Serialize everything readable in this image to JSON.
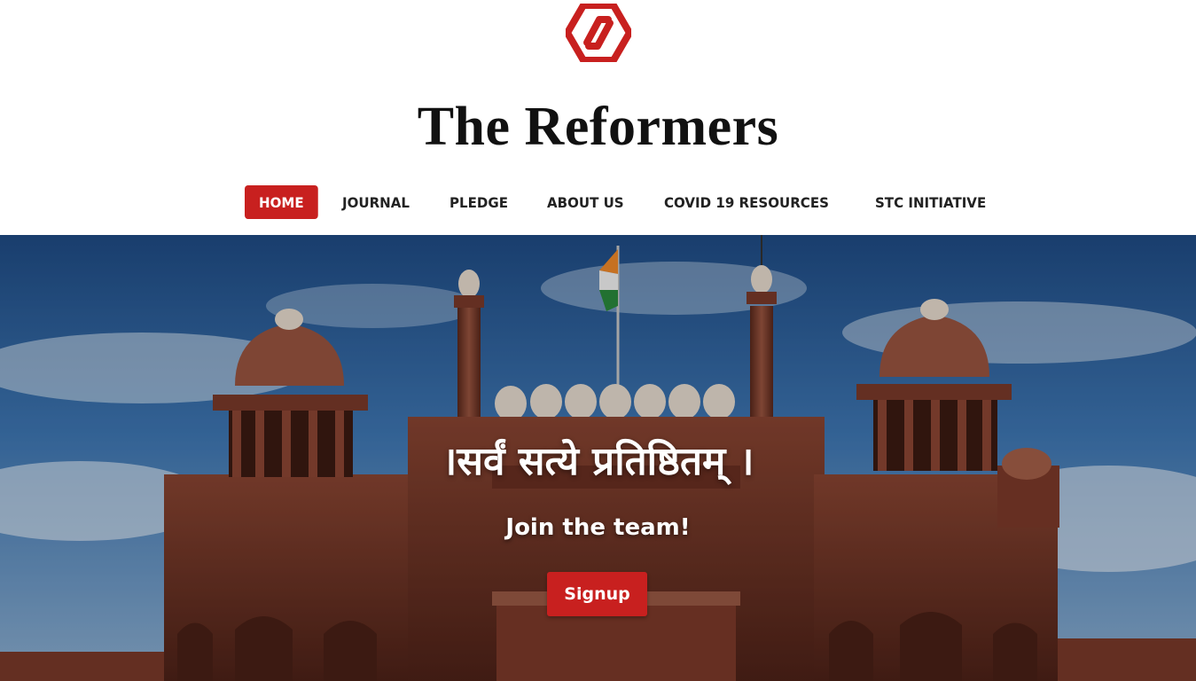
{
  "brand": {
    "logo_icon": "reformers-hexagon-logo-icon",
    "title": "The Reformers",
    "accent_color": "#c8201f"
  },
  "nav": {
    "items": [
      {
        "label": "HOME",
        "active": true
      },
      {
        "label": "JOURNAL",
        "active": false
      },
      {
        "label": "PLEDGE",
        "active": false
      },
      {
        "label": "ABOUT US",
        "active": false
      },
      {
        "label": "COVID 19 RESOURCES",
        "active": false
      },
      {
        "label": "STC INITIATIVE",
        "active": false
      }
    ]
  },
  "hero": {
    "image": "red-fort-photo",
    "motto": "।सर्वं सत्ये प्रतिष्ठितम् ।",
    "tagline": "Join the team!",
    "signup_label": "Signup"
  }
}
